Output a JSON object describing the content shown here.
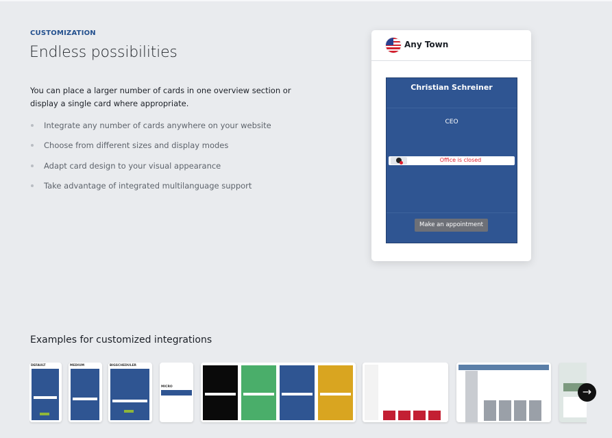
{
  "section": {
    "eyebrow": "CUSTOMIZATION",
    "title": "Endless possibilities",
    "lead": "You can place a larger number of cards in one overview section or display a single card where appropriate.",
    "features": [
      "Integrate any number of cards anywhere on your website",
      "Choose from different sizes and display modes",
      "Adapt card design to your visual appearance",
      "Take advantage of integrated multilanguage support"
    ]
  },
  "preview": {
    "header_title": "Any Town",
    "flag_icon": "us-flag-icon",
    "card": {
      "name": "Christian Schreiner",
      "role": "CEO",
      "status": "Office is closed",
      "button": "Make an appointment"
    },
    "colors": {
      "card_bg": "#2f5592",
      "status_closed": "#e01f2d",
      "button_bg": "#6d7077"
    }
  },
  "examples": {
    "title": "Examples for customized integrations",
    "labels": [
      "DEFAULT",
      "MEDIUM",
      "BIGSCHEDULER",
      "MICRO"
    ],
    "next_icon": "arrow-right-icon"
  }
}
